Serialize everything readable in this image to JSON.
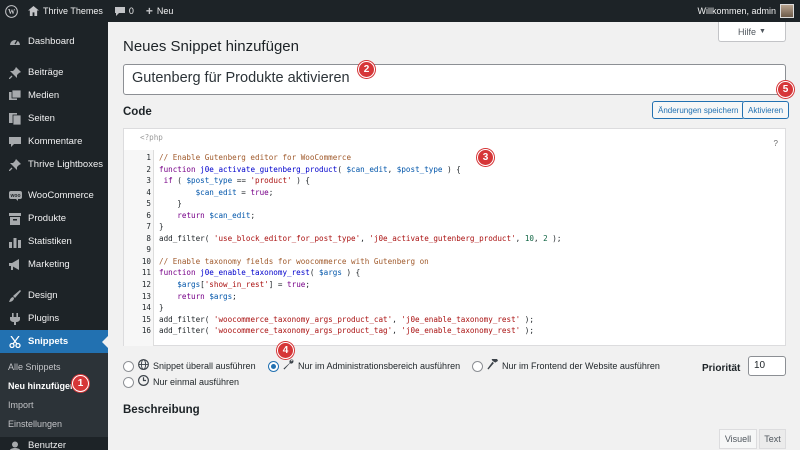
{
  "adminbar": {
    "site_name": "Thrive Themes",
    "comments_count": "0",
    "new_label": "Neu",
    "welcome": "Willkommen, admin"
  },
  "sidebar": {
    "items": [
      {
        "label": "Dashboard",
        "icon": "dashboard-icon"
      },
      {
        "label": "Beiträge",
        "icon": "pin-icon"
      },
      {
        "label": "Medien",
        "icon": "media-icon"
      },
      {
        "label": "Seiten",
        "icon": "page-icon"
      },
      {
        "label": "Kommentare",
        "icon": "comment-icon"
      },
      {
        "label": "Thrive Lightboxes",
        "icon": "thumbtack-icon"
      },
      {
        "label": "WooCommerce",
        "icon": "woo-icon"
      },
      {
        "label": "Produkte",
        "icon": "archive-icon"
      },
      {
        "label": "Statistiken",
        "icon": "bar-chart-icon"
      },
      {
        "label": "Marketing",
        "icon": "megaphone-icon"
      },
      {
        "label": "Design",
        "icon": "brush-icon"
      },
      {
        "label": "Plugins",
        "icon": "plug-icon"
      },
      {
        "label": "Snippets",
        "icon": "scissors-icon"
      }
    ],
    "submenu": [
      "Alle Snippets",
      "Neu hinzufügen",
      "Import",
      "Einstellungen"
    ],
    "cut_item": "Benutzer"
  },
  "main": {
    "help": "Hilfe",
    "title": "Neues Snippet hinzufügen",
    "snippet_name": "Gutenberg für Produkte aktivieren",
    "code_label": "Code",
    "save_btn": "Änderungen speichern",
    "activate_btn": "Aktivieren",
    "php_open": "<?php",
    "help_q": "?",
    "code_lines": [
      {
        "n": "1",
        "t": "// Enable Gutenberg editor for WooCommerce"
      },
      {
        "n": "2",
        "t": "function j0e_activate_gutenberg_product( $can_edit, $post_type ) {"
      },
      {
        "n": "3",
        "t": " if ( $post_type == 'product' ) {"
      },
      {
        "n": "4",
        "t": "        $can_edit = true;"
      },
      {
        "n": "5",
        "t": "    }"
      },
      {
        "n": "6",
        "t": "    return $can_edit;"
      },
      {
        "n": "7",
        "t": "}"
      },
      {
        "n": "8",
        "t": "add_filter( 'use_block_editor_for_post_type', 'j0e_activate_gutenberg_product', 10, 2 );"
      },
      {
        "n": "9",
        "t": ""
      },
      {
        "n": "10",
        "t": "// Enable taxonomy fields for woocommerce with Gutenberg on"
      },
      {
        "n": "11",
        "t": "function j0e_enable_taxonomy_rest( $args ) {"
      },
      {
        "n": "12",
        "t": "    $args['show_in_rest'] = true;"
      },
      {
        "n": "13",
        "t": "    return $args;"
      },
      {
        "n": "14",
        "t": "}"
      },
      {
        "n": "15",
        "t": "add_filter( 'woocommerce_taxonomy_args_product_cat', 'j0e_enable_taxonomy_rest' );"
      },
      {
        "n": "16",
        "t": "add_filter( 'woocommerce_taxonomy_args_product_tag', 'j0e_enable_taxonomy_rest' );"
      }
    ],
    "scope": {
      "everywhere": "Snippet überall ausführen",
      "admin": "Nur im Administrationsbereich ausführen",
      "frontend": "Nur im Frontend der Website ausführen",
      "once": "Nur einmal ausführen"
    },
    "priority_label": "Priorität",
    "priority_value": "10",
    "description_label": "Beschreibung",
    "tab_visual": "Visuell",
    "tab_text": "Text"
  },
  "badges": [
    "1",
    "2",
    "3",
    "4",
    "5"
  ],
  "colors": {
    "accent": "#2271b1",
    "sidebar": "#1d2327",
    "badge": "#d63638"
  }
}
